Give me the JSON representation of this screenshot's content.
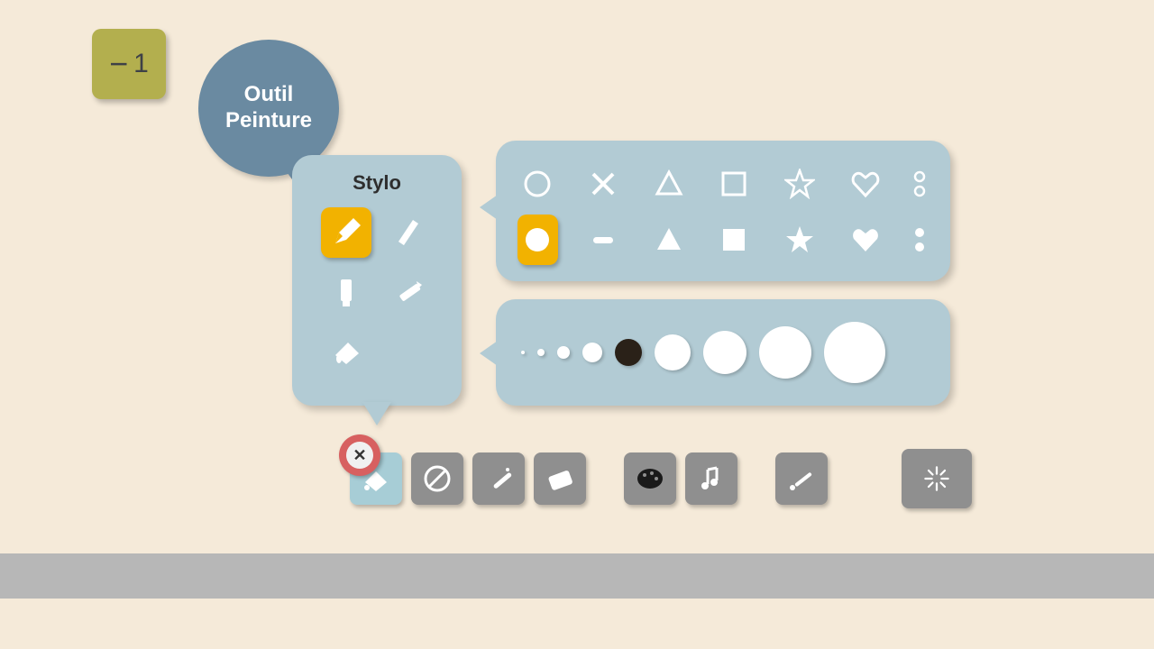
{
  "badge": {
    "minus": "−",
    "level": "1"
  },
  "toolBubble": {
    "line1": "Outil",
    "line2": "Peinture"
  },
  "styloPanel": {
    "title": "Stylo",
    "tools": [
      {
        "name": "pencil",
        "selected": true
      },
      {
        "name": "pen",
        "selected": false
      },
      {
        "name": "marker",
        "selected": false
      },
      {
        "name": "crayon",
        "selected": false
      },
      {
        "name": "bucket",
        "selected": false
      }
    ]
  },
  "shapesPanel": {
    "outlineRow": [
      "circle",
      "x",
      "triangle",
      "square",
      "star",
      "heart",
      "dots"
    ],
    "filledRow": [
      "circle",
      "dash",
      "triangle",
      "square",
      "star",
      "heart",
      "dots"
    ],
    "selected": {
      "row": "filled",
      "shape": "circle"
    }
  },
  "sizePanel": {
    "sizes": [
      4,
      8,
      14,
      22,
      30,
      40,
      48,
      58,
      68
    ],
    "selectedIndex": 4
  },
  "toolbar": {
    "items": [
      {
        "name": "paint-bucket",
        "active": true,
        "closeBadge": true
      },
      {
        "name": "no-tool"
      },
      {
        "name": "wand"
      },
      {
        "name": "eraser"
      }
    ],
    "items2": [
      {
        "name": "palette"
      },
      {
        "name": "music"
      }
    ],
    "items3": [
      {
        "name": "brush"
      }
    ],
    "items4": [
      {
        "name": "sparkle",
        "big": true
      }
    ]
  },
  "closeSymbol": "✕"
}
